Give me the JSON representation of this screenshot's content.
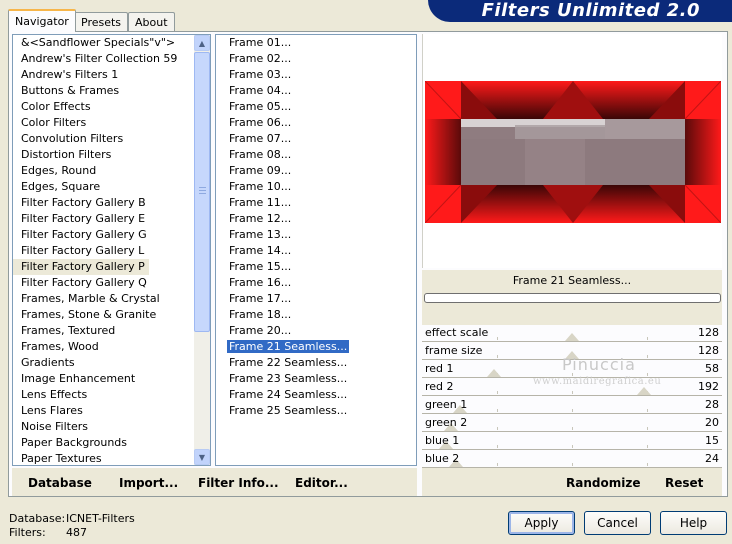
{
  "tabs": [
    {
      "label": "Navigator"
    },
    {
      "label": "Presets"
    },
    {
      "label": "About"
    }
  ],
  "title": "Filters Unlimited 2.0",
  "categories": [
    "&<Sandflower Specials\"v\">",
    "Andrew's Filter Collection 59",
    "Andrew's Filters 1",
    "Buttons & Frames",
    "Color Effects",
    "Color Filters",
    "Convolution Filters",
    "Distortion Filters",
    "Edges, Round",
    "Edges, Square",
    "Filter Factory Gallery B",
    "Filter Factory Gallery E",
    "Filter Factory Gallery G",
    "Filter Factory Gallery L",
    "Filter Factory Gallery P",
    "Filter Factory Gallery Q",
    "Frames, Marble & Crystal",
    "Frames, Stone & Granite",
    "Frames, Textured",
    "Frames, Wood",
    "Gradients",
    "Image Enhancement",
    "Lens Effects",
    "Lens Flares",
    "Noise Filters",
    "Paper Backgrounds",
    "Paper Textures"
  ],
  "selected_category": "Filter Factory Gallery P",
  "filters": [
    "Frame 01...",
    "Frame 02...",
    "Frame 03...",
    "Frame 04...",
    "Frame 05...",
    "Frame 06...",
    "Frame 07...",
    "Frame 08...",
    "Frame 09...",
    "Frame 10...",
    "Frame 11...",
    "Frame 12...",
    "Frame 13...",
    "Frame 14...",
    "Frame 15...",
    "Frame 16...",
    "Frame 17...",
    "Frame 18...",
    "Frame 20...",
    "Frame 21 Seamless...",
    "Frame 22 Seamless...",
    "Frame 23 Seamless...",
    "Frame 24 Seamless...",
    "Frame 25 Seamless..."
  ],
  "selected_filter": "Frame 21 Seamless...",
  "preview": {
    "filter_name": "Frame 21 Seamless...",
    "colors": {
      "red": "#ff1a1a",
      "dark_red": "#5a0a0a",
      "inner": "#8f7c80"
    }
  },
  "params": [
    {
      "label": "effect scale",
      "value": "128",
      "level": 0.5
    },
    {
      "label": "frame size",
      "value": "128",
      "level": 0.5
    },
    {
      "label": "red 1",
      "value": "58",
      "level": 0.227
    },
    {
      "label": "red 2",
      "value": "192",
      "level": 0.753
    },
    {
      "label": "green 1",
      "value": "28",
      "level": 0.11
    },
    {
      "label": "green 2",
      "value": "20",
      "level": 0.078
    },
    {
      "label": "blue 1",
      "value": "15",
      "level": 0.059
    },
    {
      "label": "blue 2",
      "value": "24",
      "level": 0.094
    }
  ],
  "watermark": {
    "name": "Pinuccia",
    "site": "www.maidiregrafica.eu"
  },
  "toolbar": {
    "database": "Database",
    "import": "Import...",
    "filter_info": "Filter Info...",
    "editor": "Editor...",
    "randomize": "Randomize",
    "reset": "Reset"
  },
  "footer": {
    "database_label": "Database:",
    "database_value": "ICNET-Filters",
    "filters_label": "Filters:",
    "filters_value": "487"
  },
  "buttons": {
    "apply": "Apply",
    "cancel": "Cancel",
    "help": "Help"
  }
}
